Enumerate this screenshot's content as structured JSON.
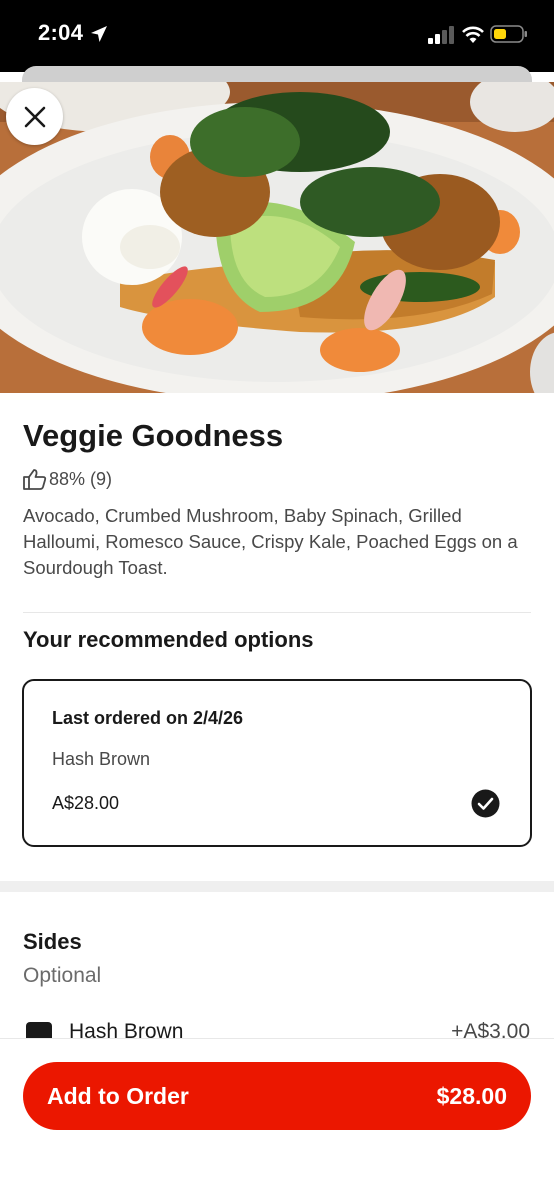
{
  "status_bar": {
    "time": "2:04",
    "icons": [
      "location-arrow-icon",
      "signal-icon",
      "wifi-icon",
      "battery-icon"
    ]
  },
  "hero": {
    "close_icon": "close-icon"
  },
  "item": {
    "title": "Veggie Goodness",
    "rating": "88% (9)",
    "rating_icon": "thumbs-up-icon",
    "description": "Avocado,  Crumbed Mushroom, Baby Spinach, Grilled Halloumi, Romesco Sauce, Crispy Kale,  Poached Eggs on a Sourdough Toast."
  },
  "recommended": {
    "title": "Your recommended options",
    "card": {
      "last_ordered": "Last ordered on 2/4/26",
      "option": "Hash Brown",
      "price": "A$28.00",
      "selected": true
    }
  },
  "sides": {
    "title": "Sides",
    "subtitle": "Optional",
    "items": [
      {
        "label": "Hash Brown",
        "price": "+A$3.00",
        "checked": true
      }
    ]
  },
  "footer": {
    "button_label": "Add to Order",
    "button_price": "$28.00"
  },
  "colors": {
    "accent": "#eb1700",
    "text_primary": "#191919",
    "text_secondary": "#494949"
  }
}
